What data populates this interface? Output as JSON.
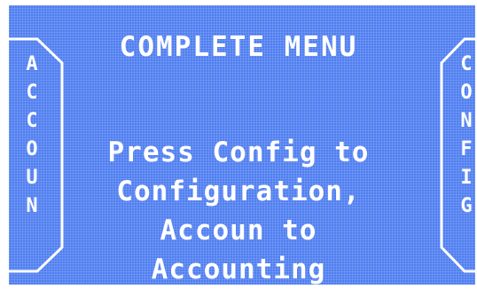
{
  "screen": {
    "title": "COMPLETE MENU",
    "message_lines": [
      "Press Config to",
      "Configuration,",
      "Accoun to",
      "Accounting"
    ]
  },
  "left_button": {
    "label": "ACCOUN",
    "letters": [
      "A",
      "C",
      "C",
      "O",
      "U",
      "N"
    ]
  },
  "right_button": {
    "label": "CONFIG",
    "letters": [
      "C",
      "O",
      "N",
      "F",
      "I",
      "G"
    ]
  },
  "colors": {
    "screen_background": "#4f7ef0",
    "text": "#ffffff"
  }
}
